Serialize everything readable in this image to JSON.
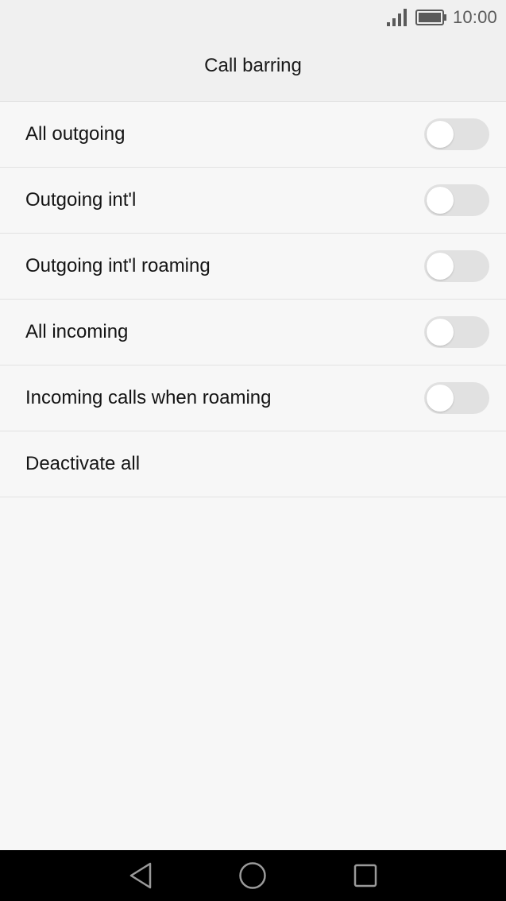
{
  "status_bar": {
    "time": "10:00",
    "signal_icon": "signal-icon",
    "battery_icon": "battery-full-icon"
  },
  "header": {
    "title": "Call barring"
  },
  "settings": {
    "items": [
      {
        "label": "All outgoing",
        "has_toggle": true,
        "toggle_on": false
      },
      {
        "label": "Outgoing int'l",
        "has_toggle": true,
        "toggle_on": false
      },
      {
        "label": "Outgoing int'l roaming",
        "has_toggle": true,
        "toggle_on": false
      },
      {
        "label": "All incoming",
        "has_toggle": true,
        "toggle_on": false
      },
      {
        "label": "Incoming calls when roaming",
        "has_toggle": true,
        "toggle_on": false
      },
      {
        "label": "Deactivate all",
        "has_toggle": false
      }
    ]
  },
  "navigation": {
    "back_icon": "back-triangle-icon",
    "home_icon": "home-circle-icon",
    "recents_icon": "recents-square-icon"
  },
  "colors": {
    "toggle_off_track": "#e1e1e1",
    "toggle_knob": "#ffffff",
    "header_bg": "#f0f0f0",
    "page_bg": "#f7f7f7",
    "nav_bg": "#000000"
  }
}
